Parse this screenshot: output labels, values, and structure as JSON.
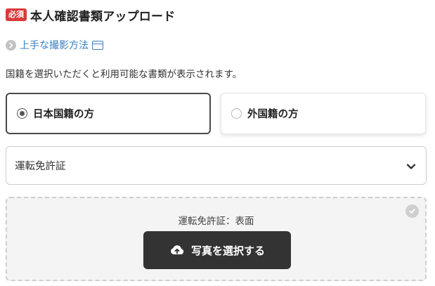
{
  "header": {
    "badge": "必須",
    "title": "本人確認書類アップロード"
  },
  "howto": {
    "link_label": "上手な撮影方法"
  },
  "description": "国籍を選択いただくと利用可能な書類が表示されます。",
  "nationality": {
    "options": [
      {
        "label": "日本国籍の方",
        "selected": true
      },
      {
        "label": "外国籍の方",
        "selected": false
      }
    ]
  },
  "document_select": {
    "value": "運転免許証"
  },
  "upload": {
    "label": "運転免許証：表面",
    "button_label": "写真を選択する"
  },
  "icons": {
    "howto_chevron": "chevron-right-icon",
    "howto_window": "window-icon",
    "select_arrow": "chevron-down-icon",
    "upload_check": "check-circle-icon",
    "upload_cloud": "cloud-upload-icon"
  },
  "colors": {
    "required_badge": "#d93a3a",
    "link": "#3a7fc0",
    "button_bg": "#333333",
    "upload_bg": "#f4f4f4"
  }
}
